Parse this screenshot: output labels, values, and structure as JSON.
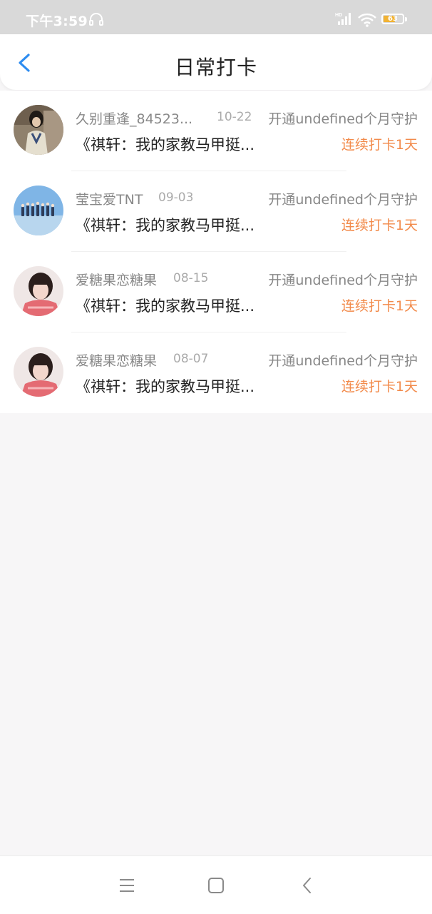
{
  "status_bar": {
    "time": "下午3:59",
    "battery": "63",
    "battery_level_percent": 63,
    "signal_label": "HD"
  },
  "header": {
    "title": "日常打卡",
    "back_icon": "chevron-left-icon",
    "accent_color": "#2d8cf0"
  },
  "list": [
    {
      "name": "久别重逢_84523...",
      "date": "10-22",
      "guard": "开通undefined个月守护",
      "book": "《祺轩：我的家教马甲挺...",
      "streak": "连续打卡1天"
    },
    {
      "name": "莹宝爱TNT",
      "date": "09-03",
      "guard": "开通undefined个月守护",
      "book": "《祺轩：我的家教马甲挺...",
      "streak": "连续打卡1天"
    },
    {
      "name": "爱糖果恋糖果",
      "date": "08-15",
      "guard": "开通undefined个月守护",
      "book": "《祺轩：我的家教马甲挺...",
      "streak": "连续打卡1天"
    },
    {
      "name": "爱糖果恋糖果",
      "date": "08-07",
      "guard": "开通undefined个月守护",
      "book": "《祺轩：我的家教马甲挺...",
      "streak": "连续打卡1天"
    }
  ],
  "colors": {
    "streak": "#f28a4a",
    "muted_text": "#888888",
    "title_text": "#222222"
  },
  "nav_bar": {
    "icons": [
      "menu-icon",
      "home-square-icon",
      "back-chevron-icon"
    ]
  }
}
